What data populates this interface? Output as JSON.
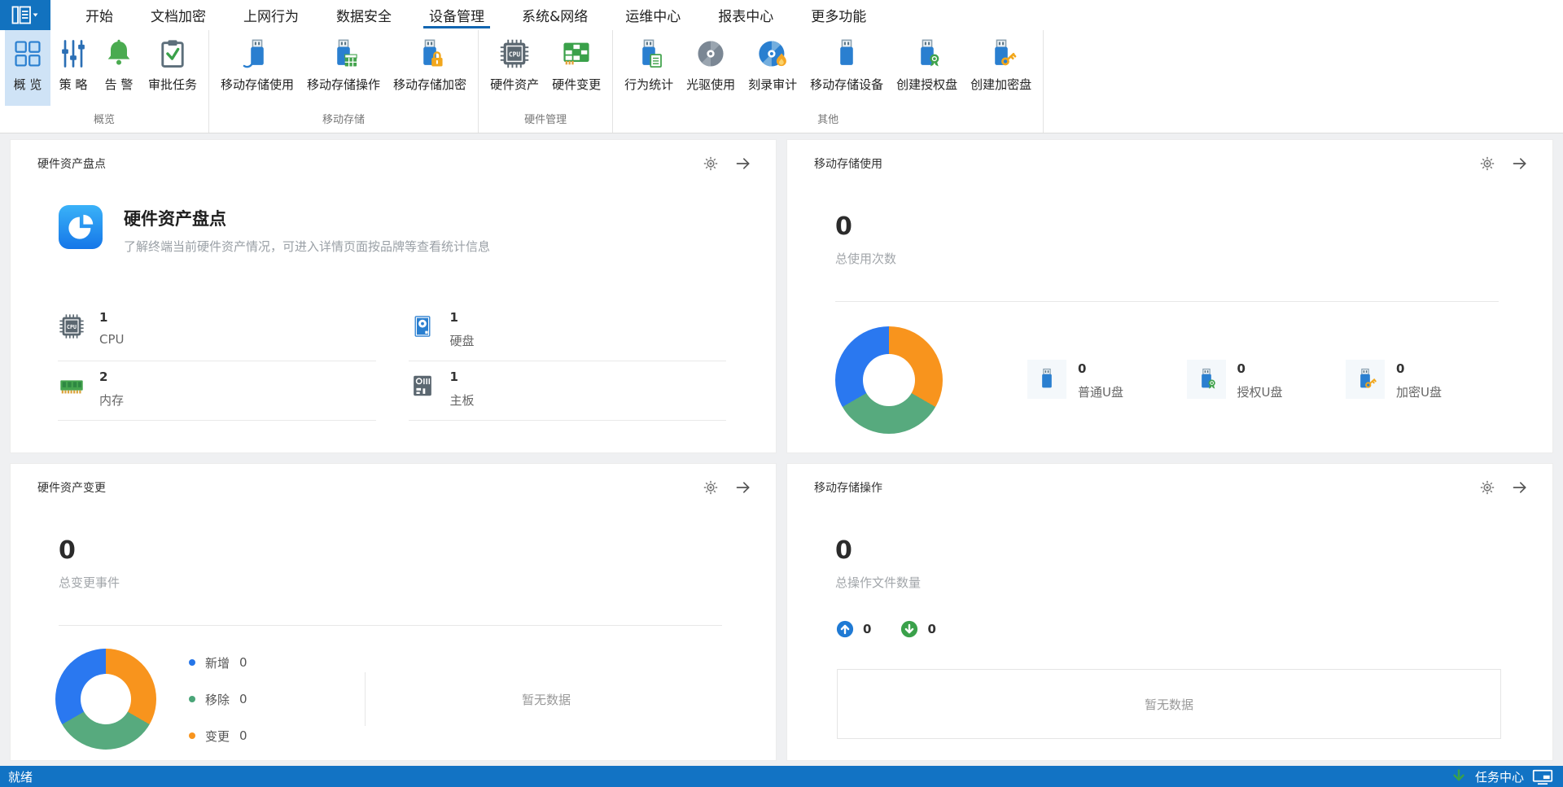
{
  "menubar": {
    "app_button": {
      "icon": "app-menu-icon"
    },
    "items": [
      {
        "label": "开始",
        "active": false
      },
      {
        "label": "文档加密",
        "active": false
      },
      {
        "label": "上网行为",
        "active": false
      },
      {
        "label": "数据安全",
        "active": false
      },
      {
        "label": "设备管理",
        "active": true
      },
      {
        "label": "系统&网络",
        "active": false
      },
      {
        "label": "运维中心",
        "active": false
      },
      {
        "label": "报表中心",
        "active": false
      },
      {
        "label": "更多功能",
        "active": false
      }
    ]
  },
  "ribbon": {
    "groups": [
      {
        "label": "概览",
        "items": [
          {
            "label": "概 览",
            "icon": "overview-grid-icon",
            "selected": true
          },
          {
            "label": "策 略",
            "icon": "policy-sliders-icon",
            "selected": false
          },
          {
            "label": "告 警",
            "icon": "alert-bell-icon",
            "selected": false
          },
          {
            "label": "审批任务",
            "icon": "approval-clipboard-icon",
            "selected": false
          }
        ]
      },
      {
        "label": "移动存储",
        "items": [
          {
            "label": "移动存储使用",
            "icon": "usb-usage-icon",
            "selected": false
          },
          {
            "label": "移动存储操作",
            "icon": "usb-operation-icon",
            "selected": false
          },
          {
            "label": "移动存储加密",
            "icon": "usb-encrypt-icon",
            "selected": false
          }
        ]
      },
      {
        "label": "硬件管理",
        "items": [
          {
            "label": "硬件资产",
            "icon": "cpu-chip-icon",
            "selected": false
          },
          {
            "label": "硬件变更",
            "icon": "hardware-change-icon",
            "selected": false
          }
        ]
      },
      {
        "label": "其他",
        "items": [
          {
            "label": "行为统计",
            "icon": "usb-stats-icon",
            "selected": false
          },
          {
            "label": "光驱使用",
            "icon": "cd-drive-icon",
            "selected": false
          },
          {
            "label": "刻录审计",
            "icon": "cd-burn-icon",
            "selected": false
          },
          {
            "label": "移动存储设备",
            "icon": "usb-device-icon",
            "selected": false
          },
          {
            "label": "创建授权盘",
            "icon": "usb-authorize-icon",
            "selected": false
          },
          {
            "label": "创建加密盘",
            "icon": "usb-key-icon",
            "selected": false
          }
        ]
      }
    ]
  },
  "cards": {
    "hardware_inventory": {
      "title": "硬件资产盘点",
      "intro_title": "硬件资产盘点",
      "intro_desc": "了解终端当前硬件资产情况，可进入详情页面按品牌等查看统计信息",
      "stats": [
        {
          "value": "1",
          "label": "CPU",
          "icon": "cpu-chip-icon"
        },
        {
          "value": "1",
          "label": "硬盘",
          "icon": "hard-disk-icon"
        },
        {
          "value": "2",
          "label": "内存",
          "icon": "memory-icon"
        },
        {
          "value": "1",
          "label": "主板",
          "icon": "motherboard-icon"
        }
      ]
    },
    "storage_usage": {
      "title": "移动存储使用",
      "total_value": "0",
      "total_label": "总使用次数",
      "donut_colors": [
        "#f8941d",
        "#57aa7e",
        "#2a78f0"
      ],
      "legend": [
        {
          "value": "0",
          "label": "普通U盘",
          "icon": "usb-plain-icon"
        },
        {
          "value": "0",
          "label": "授权U盘",
          "icon": "usb-authorize-icon"
        },
        {
          "value": "0",
          "label": "加密U盘",
          "icon": "usb-key-icon"
        }
      ]
    },
    "hardware_change": {
      "title": "硬件资产变更",
      "total_value": "0",
      "total_label": "总变更事件",
      "donut_colors": [
        "#f8941d",
        "#57aa7e",
        "#2a78f0"
      ],
      "legend": [
        {
          "label": "新增",
          "value": "0",
          "color": "#2575e8"
        },
        {
          "label": "移除",
          "value": "0",
          "color": "#4aa578"
        },
        {
          "label": "变更",
          "value": "0",
          "color": "#f8941d"
        }
      ],
      "empty_text": "暂无数据"
    },
    "storage_operation": {
      "title": "移动存储操作",
      "total_value": "0",
      "total_label": "总操作文件数量",
      "copy_in": {
        "value": "0",
        "icon": "upload-circle-icon"
      },
      "copy_out": {
        "value": "0",
        "icon": "download-circle-icon"
      },
      "empty_text": "暂无数据"
    }
  },
  "statusbar": {
    "ready_text": "就绪",
    "task_center_label": "任务中心"
  }
}
